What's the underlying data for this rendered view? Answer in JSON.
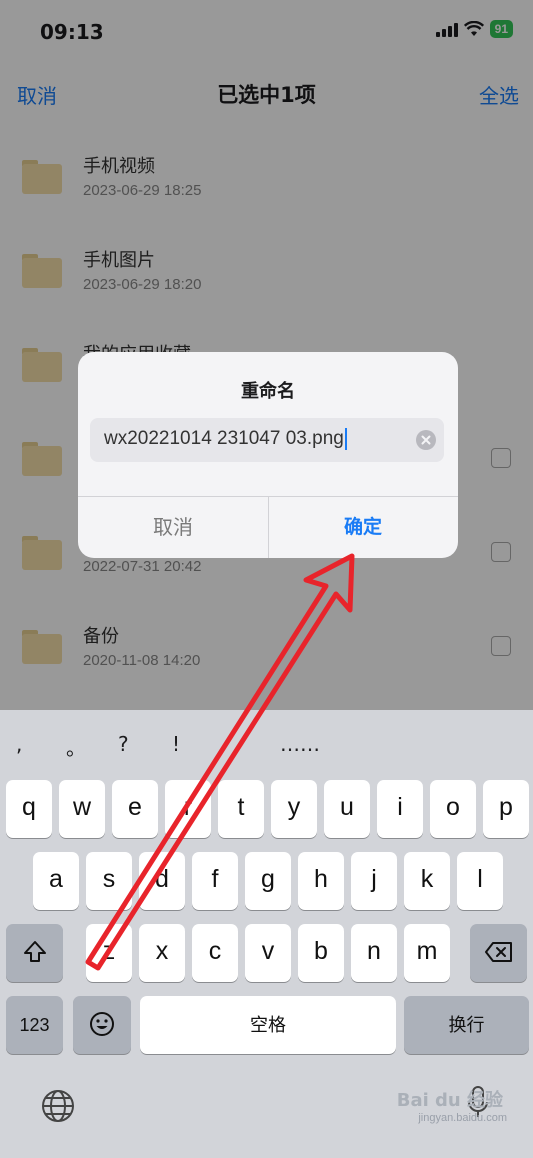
{
  "status_bar": {
    "time": "09:13",
    "battery": "91"
  },
  "nav": {
    "cancel": "取消",
    "title": "已选中1项",
    "select_all": "全选"
  },
  "files": [
    {
      "name": "手机视频",
      "date": "2023-06-29 18:25"
    },
    {
      "name": "手机图片",
      "date": "2023-06-29 18:20"
    },
    {
      "name": "我的应用收藏",
      "date": ""
    },
    {
      "name": "",
      "date": ""
    },
    {
      "name": "",
      "date": "2022-07-31 20:42"
    },
    {
      "name": "备份",
      "date": "2020-11-08 14:20"
    }
  ],
  "dialog": {
    "title": "重命名",
    "value": "wx20221014 231047 03.png",
    "cancel": "取消",
    "ok": "确定"
  },
  "keyboard": {
    "candidates": [
      ",",
      "。",
      "?",
      "!",
      "……"
    ],
    "row1": [
      "q",
      "w",
      "e",
      "r",
      "t",
      "y",
      "u",
      "i",
      "o",
      "p"
    ],
    "row2": [
      "a",
      "s",
      "d",
      "f",
      "g",
      "h",
      "j",
      "k",
      "l"
    ],
    "row3": [
      "z",
      "x",
      "c",
      "v",
      "b",
      "n",
      "m"
    ],
    "num_key": "123",
    "space": "空格",
    "return": "换行"
  },
  "watermark": {
    "logo": "Bai du 经验",
    "url": "jingyan.baidu.com"
  },
  "colors": {
    "accent": "#1a7cf5",
    "arrow": "#e8242b"
  }
}
